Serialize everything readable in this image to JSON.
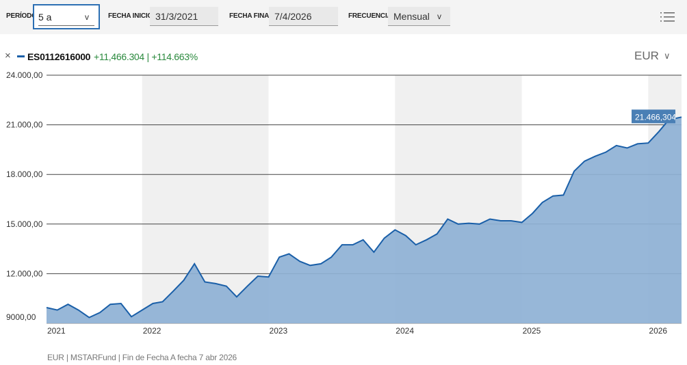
{
  "toolbar": {
    "period_label": "PERÍODO",
    "period_value": "5 a",
    "start_label": "FECHA INICIO",
    "start_value": "31/3/2021",
    "end_label": "FECHA FINAL",
    "end_value": "7/4/2026",
    "freq_label": "FRECUENCIA",
    "freq_value": "Mensual",
    "menu_icon": "list-menu-icon"
  },
  "legend": {
    "close_symbol": "×",
    "series_code": "ES0112616000",
    "change_text": "+11,466.304 | +114.663%",
    "currency": "EUR",
    "line_color": "#1a5fa8",
    "gain_color": "#2b8a3e"
  },
  "chart_data": {
    "type": "area",
    "ylim": [
      9000,
      24000
    ],
    "yticks": [
      {
        "value": 24000,
        "label": "24.000,00"
      },
      {
        "value": 21000,
        "label": "21.000,00"
      },
      {
        "value": 18000,
        "label": "18.000,00"
      },
      {
        "value": 15000,
        "label": "15.000,00"
      },
      {
        "value": 12000,
        "label": "12.000,00"
      },
      {
        "value": 9000,
        "label": "9000,00"
      }
    ],
    "x_tick_labels": [
      "2021",
      "2022",
      "2023",
      "2024",
      "2025",
      "2026"
    ],
    "x_start": "2021-03-31",
    "x_end": "2026-04-07",
    "end_label": "21.466,304",
    "fill_color": "#8eb1d5",
    "line_color": "#1a5fa8",
    "series": [
      {
        "dates": [
          "2021-03-31",
          "2021-05-01",
          "2021-06-01",
          "2021-07-01",
          "2021-08-01",
          "2021-09-01",
          "2021-10-01",
          "2021-11-01",
          "2021-12-01",
          "2022-01-01",
          "2022-02-01",
          "2022-03-01",
          "2022-04-01",
          "2022-05-01",
          "2022-06-01",
          "2022-07-01",
          "2022-08-01",
          "2022-09-01",
          "2022-10-01",
          "2022-11-01",
          "2022-12-01",
          "2023-01-01",
          "2023-02-01",
          "2023-03-01",
          "2023-04-01",
          "2023-05-01",
          "2023-06-01",
          "2023-07-01",
          "2023-08-01",
          "2023-09-01",
          "2023-10-01",
          "2023-11-01",
          "2023-12-01",
          "2024-01-01",
          "2024-02-01",
          "2024-03-01",
          "2024-04-01",
          "2024-05-01",
          "2024-06-01",
          "2024-07-01",
          "2024-08-01",
          "2024-09-01",
          "2024-10-01",
          "2024-11-01",
          "2024-12-01",
          "2025-01-01",
          "2025-02-01",
          "2025-03-01",
          "2025-04-01",
          "2025-05-01",
          "2025-06-01",
          "2025-07-01",
          "2025-08-01",
          "2025-09-01",
          "2025-10-01",
          "2025-11-01",
          "2025-12-01",
          "2026-01-01",
          "2026-02-01",
          "2026-03-01",
          "2026-04-07"
        ],
        "values": [
          9950,
          9800,
          10150,
          9800,
          9350,
          9650,
          10150,
          10200,
          9400,
          9800,
          10200,
          10300,
          10950,
          11600,
          12600,
          11500,
          11400,
          11250,
          10600,
          11250,
          11850,
          11800,
          13000,
          13200,
          12750,
          12500,
          12600,
          13000,
          13750,
          13750,
          14050,
          13300,
          14150,
          14650,
          14300,
          13750,
          14050,
          14400,
          15300,
          15000,
          15050,
          15000,
          15300,
          15200,
          15200,
          15100,
          15650,
          16300,
          16700,
          16750,
          18200,
          18800,
          19100,
          19350,
          19750,
          19600,
          19850,
          19900,
          20600,
          21300,
          21466
        ]
      }
    ]
  },
  "footer": {
    "text": "EUR | MSTARFund | Fin de Fecha A fecha 7 abr 2026"
  }
}
